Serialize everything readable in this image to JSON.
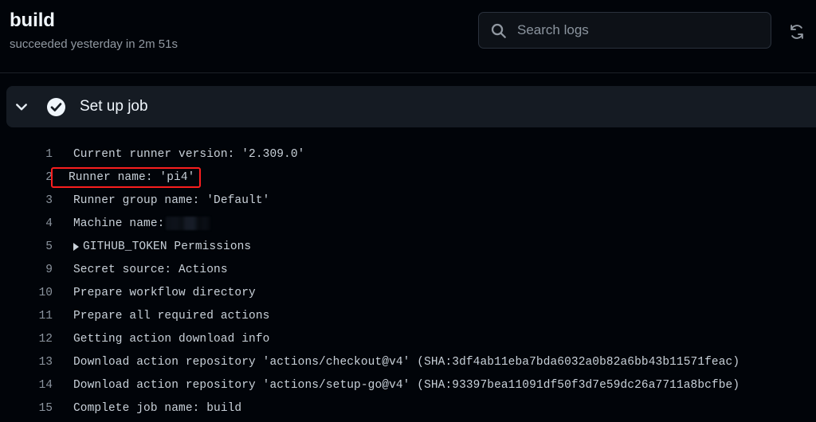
{
  "header": {
    "job_title": "build",
    "job_status": "succeeded yesterday in 2m 51s",
    "search": {
      "placeholder": "Search logs",
      "value": "",
      "icon": "search-icon"
    },
    "refresh": {
      "icon": "refresh-icon",
      "label": "Refresh logs"
    }
  },
  "step": {
    "title": "Set up job",
    "expanded": true,
    "chevron_icon": "chevron-down-icon",
    "status_icon": "check-circle-icon",
    "status": "succeeded"
  },
  "annotation": {
    "color": "#fa1e1e",
    "target_line": "2"
  },
  "colors": {
    "page_background": "#010409",
    "step_bar_background": "#151b23",
    "search_background": "#0d1117",
    "search_border": "#2a313c",
    "text_primary": "#f0f6fc",
    "text_log": "#c9d1d9",
    "text_muted": "#8b949e",
    "annotation_red": "#fa1e1e"
  },
  "log_lines": [
    {
      "number": "1",
      "text": "Current runner version: '2.309.0'",
      "annotated": false,
      "collapsible": false,
      "redacted": false
    },
    {
      "number": "2",
      "text": "Runner name: 'pi4'",
      "annotated": true,
      "collapsible": false,
      "redacted": false
    },
    {
      "number": "3",
      "text": "Runner group name: 'Default'",
      "annotated": false,
      "collapsible": false,
      "redacted": false
    },
    {
      "number": "4",
      "text": "Machine name:",
      "annotated": false,
      "collapsible": false,
      "redacted": true
    },
    {
      "number": "5",
      "text": "GITHUB_TOKEN Permissions",
      "annotated": false,
      "collapsible": true,
      "redacted": false
    },
    {
      "number": "9",
      "text": "Secret source: Actions",
      "annotated": false,
      "collapsible": false,
      "redacted": false
    },
    {
      "number": "10",
      "text": "Prepare workflow directory",
      "annotated": false,
      "collapsible": false,
      "redacted": false
    },
    {
      "number": "11",
      "text": "Prepare all required actions",
      "annotated": false,
      "collapsible": false,
      "redacted": false
    },
    {
      "number": "12",
      "text": "Getting action download info",
      "annotated": false,
      "collapsible": false,
      "redacted": false
    },
    {
      "number": "13",
      "text": "Download action repository 'actions/checkout@v4' (SHA:3df4ab11eba7bda6032a0b82a6bb43b11571feac)",
      "annotated": false,
      "collapsible": false,
      "redacted": false
    },
    {
      "number": "14",
      "text": "Download action repository 'actions/setup-go@v4' (SHA:93397bea11091df50f3d7e59dc26a7711a8bcfbe)",
      "annotated": false,
      "collapsible": false,
      "redacted": false
    },
    {
      "number": "15",
      "text": "Complete job name: build",
      "annotated": false,
      "collapsible": false,
      "redacted": false
    }
  ]
}
